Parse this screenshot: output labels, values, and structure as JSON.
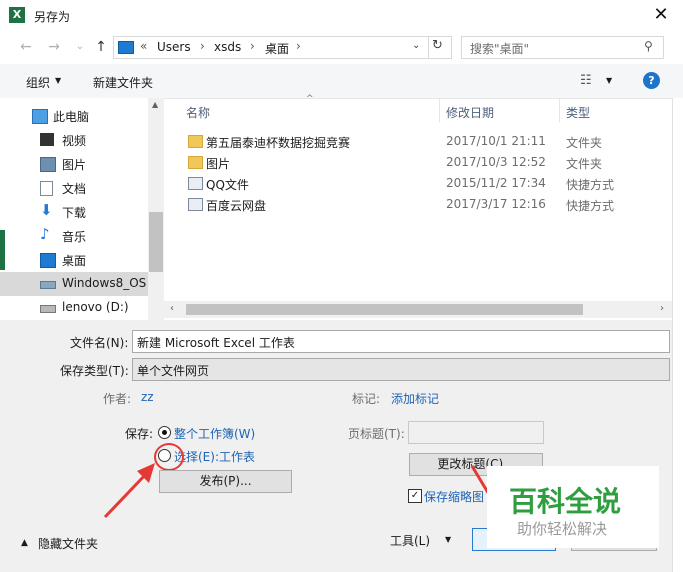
{
  "window": {
    "title": "另存为",
    "app_icon": "X"
  },
  "nav": {
    "path": [
      "Users",
      "xsds",
      "桌面"
    ],
    "overflow": "«",
    "separator": "›",
    "search_placeholder": "搜索\"桌面\""
  },
  "toolbar": {
    "organize": "组织",
    "new_folder": "新建文件夹",
    "help": "?"
  },
  "sidebar": {
    "items": [
      {
        "label": "此电脑",
        "icon": "pc-icon"
      },
      {
        "label": "视频",
        "icon": "video-icon"
      },
      {
        "label": "图片",
        "icon": "picture-icon"
      },
      {
        "label": "文档",
        "icon": "document-icon"
      },
      {
        "label": "下载",
        "icon": "download-icon"
      },
      {
        "label": "音乐",
        "icon": "music-icon"
      },
      {
        "label": "桌面",
        "icon": "desktop-icon"
      },
      {
        "label": "Windows8_OS",
        "icon": "drive-icon"
      },
      {
        "label": "lenovo (D:)",
        "icon": "drive-icon"
      }
    ]
  },
  "file_list": {
    "headers": {
      "name": "名称",
      "date": "修改日期",
      "type": "类型"
    },
    "rows": [
      {
        "name": "第五届泰迪杯数据挖掘竞赛",
        "date": "2017/10/1 21:11",
        "type": "文件夹"
      },
      {
        "name": "图片",
        "date": "2017/10/3 12:52",
        "type": "文件夹"
      },
      {
        "name": "QQ文件",
        "date": "2015/11/2 17:34",
        "type": "快捷方式"
      },
      {
        "name": "百度云网盘",
        "date": "2017/3/17 12:16",
        "type": "快捷方式"
      }
    ]
  },
  "form": {
    "filename_label": "文件名(N):",
    "filename_value": "新建 Microsoft Excel 工作表",
    "filetype_label": "保存类型(T):",
    "filetype_value": "单个文件网页",
    "author_label": "作者:",
    "author_value": "zz",
    "tags_label": "标记:",
    "tags_value": "添加标记",
    "save_label": "保存:",
    "radio_workbook": "整个工作簿(W)",
    "radio_selection": "选择(E):工作表",
    "publish_button": "发布(P)...",
    "page_title_label": "页标题(T):",
    "change_title_button": "更改标题(C)...",
    "thumbnail_checkbox": "保存缩略图",
    "hide_folders": "隐藏文件夹",
    "tools_button": "工具(L)"
  },
  "watermark": {
    "title": "百科全说",
    "subtitle": "助你轻松解决"
  }
}
